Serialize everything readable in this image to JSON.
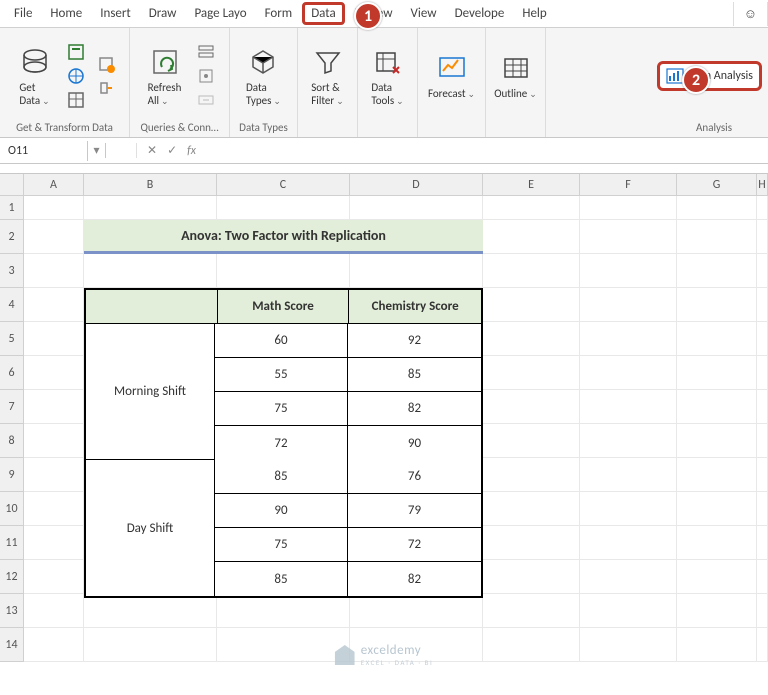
{
  "menu": {
    "tabs": [
      "File",
      "Home",
      "Insert",
      "Draw",
      "Page Layo",
      "Form",
      "Data",
      "Review",
      "View",
      "Develope",
      "Help"
    ],
    "selected": "Data",
    "smile": "☺"
  },
  "ribbon": {
    "groups": [
      {
        "label": "Get & Transform Data",
        "buttons": [
          {
            "name": "get-data",
            "label": "Get\nData"
          }
        ]
      },
      {
        "label": "Queries & Conn…",
        "buttons": [
          {
            "name": "refresh-all",
            "label": "Refresh\nAll"
          }
        ]
      },
      {
        "label": "Data Types",
        "buttons": [
          {
            "name": "data-types",
            "label": "Data\nTypes"
          }
        ]
      },
      {
        "label": "",
        "buttons": [
          {
            "name": "sort-filter",
            "label": "Sort &\nFilter"
          }
        ]
      },
      {
        "label": "",
        "buttons": [
          {
            "name": "data-tools",
            "label": "Data\nTools"
          }
        ]
      },
      {
        "label": "",
        "buttons": [
          {
            "name": "forecast",
            "label": "Forecast"
          }
        ]
      },
      {
        "label": "",
        "buttons": [
          {
            "name": "outline",
            "label": "Outline"
          }
        ]
      },
      {
        "label": "Analysis",
        "buttons": [
          {
            "name": "data-analysis",
            "label": "Data Analysis"
          }
        ]
      }
    ]
  },
  "callouts": {
    "c1": "1",
    "c2": "2"
  },
  "namebox": {
    "ref": "O11",
    "fx": "fx"
  },
  "columns": [
    "A",
    "B",
    "C",
    "D",
    "E",
    "F",
    "G",
    "H"
  ],
  "rows": [
    "1",
    "2",
    "3",
    "4",
    "5",
    "6",
    "7",
    "8",
    "9",
    "10",
    "11",
    "12",
    "13",
    "14"
  ],
  "title": "Anova: Two Factor with Replication",
  "table": {
    "headers": [
      "",
      "Math Score",
      "Chemistry Score"
    ],
    "blocks": [
      {
        "shift": "Morning Shift",
        "rows": [
          [
            "60",
            "92"
          ],
          [
            "55",
            "85"
          ],
          [
            "75",
            "82"
          ],
          [
            "72",
            "90"
          ]
        ]
      },
      {
        "shift": "Day Shift",
        "rows": [
          [
            "85",
            "76"
          ],
          [
            "90",
            "79"
          ],
          [
            "75",
            "72"
          ],
          [
            "85",
            "82"
          ]
        ]
      }
    ]
  },
  "watermark": {
    "brand": "exceldemy",
    "tagline": "EXCEL · DATA · BI"
  }
}
